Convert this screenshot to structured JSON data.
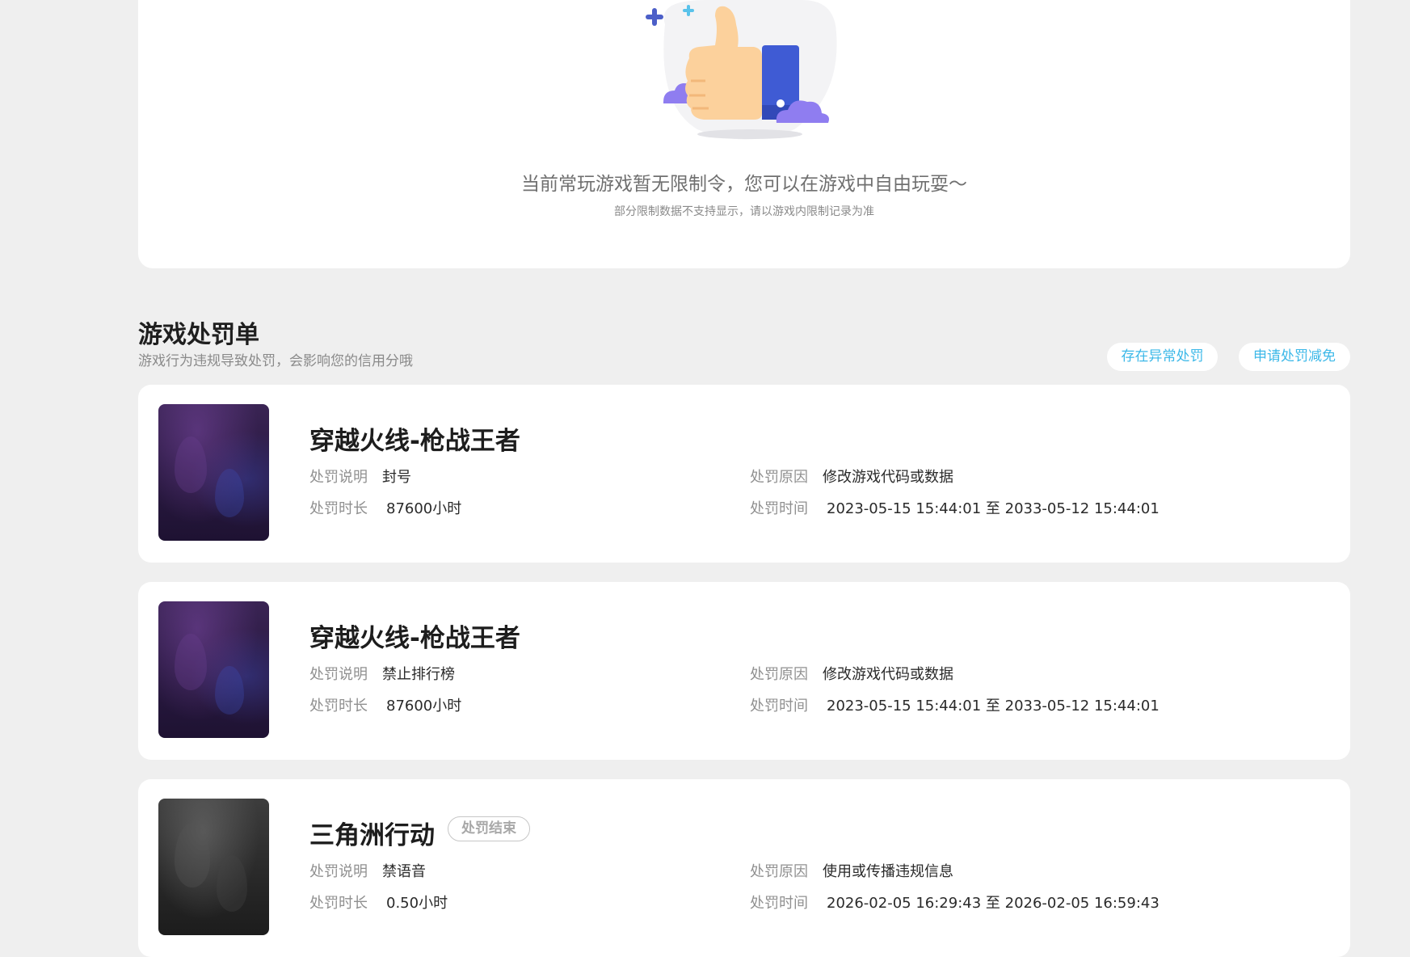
{
  "empty_state": {
    "title": "当前常玩游戏暂无限制令，您可以在游戏中自由玩耍～",
    "subtitle": "部分限制数据不支持显示，请以游戏内限制记录为准",
    "illustration_icon": "thumbs-up-icon"
  },
  "penalty_section": {
    "title": "游戏处罚单",
    "subtitle": "游戏行为违规导致处罚，会影响您的信用分哦",
    "btn_abnormal": "存在异常处罚",
    "btn_reduce": "申请处罚减免"
  },
  "labels": {
    "desc": "处罚说明",
    "reason": "处罚原因",
    "duration": "处罚时长",
    "time": "处罚时间"
  },
  "penalties": [
    {
      "game": "穿越火线-枪战王者",
      "desc": "封号",
      "reason": "修改游戏代码或数据",
      "duration": "87600小时",
      "time": "2023-05-15 15:44:01 至 2033-05-12 15:44:01",
      "badge": "",
      "thumb_color": "purple"
    },
    {
      "game": "穿越火线-枪战王者",
      "desc": "禁止排行榜",
      "reason": "修改游戏代码或数据",
      "duration": "87600小时",
      "time": "2023-05-15 15:44:01 至 2033-05-12 15:44:01",
      "badge": "",
      "thumb_color": "purple"
    },
    {
      "game": "三角洲行动",
      "desc": "禁语音",
      "reason": "使用或传播违规信息",
      "duration": "0.50小时",
      "time": "2026-02-05 16:29:43 至 2026-02-05 16:59:43",
      "badge": "处罚结束",
      "thumb_color": "gray"
    }
  ],
  "colors": {
    "page_bg": "#efefef",
    "accent": "#3cb8e8",
    "thumb_hand": "#fcd19c",
    "thumb_cuff": "#3f5bd4",
    "cloud": "#8f7df0"
  }
}
